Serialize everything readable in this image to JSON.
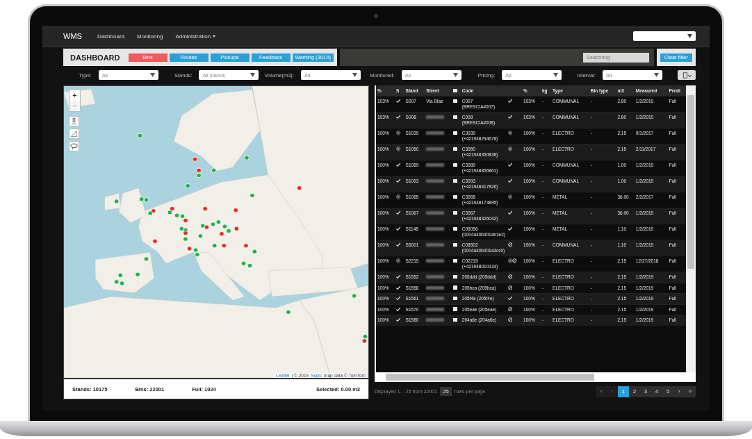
{
  "navbar": {
    "brand": "WMS",
    "items": [
      {
        "label": "Dashboard",
        "dropdown": false
      },
      {
        "label": "Monitoring",
        "dropdown": false
      },
      {
        "label": "Administration",
        "dropdown": true
      }
    ]
  },
  "toolbar": {
    "title": "DASHBOARD",
    "tabs": [
      {
        "label": "Bins",
        "selected": true
      },
      {
        "label": "Routes",
        "selected": false
      },
      {
        "label": "Pickups",
        "selected": false
      },
      {
        "label": "Feedback",
        "selected": false
      },
      {
        "label": "Warning (3014)",
        "selected": false
      }
    ],
    "search": {
      "placeholder": "Searching"
    },
    "clear_button": "Clear filter"
  },
  "filters": [
    {
      "label": "Type:",
      "value": "All"
    },
    {
      "label": "Stands:",
      "value": "All stands"
    },
    {
      "label": "Volume(m3):",
      "value": "All"
    },
    {
      "label": "Monitored:",
      "value": "All"
    },
    {
      "label": "Pricing:",
      "value": "All"
    },
    {
      "label": "Interval:",
      "value": "All"
    }
  ],
  "map": {
    "zoom_in": "+",
    "zoom_out": "−",
    "zoom_out_disabled": true,
    "attribution": [
      {
        "text": "Leaflet",
        "link": true
      },
      {
        "text": "| © 2019",
        "link": false
      },
      {
        "text": "Sygic",
        "link": true
      },
      {
        "text": "map data © TomTom",
        "link": false
      }
    ],
    "stats": [
      "Stands: 10175",
      "Bins: 22001",
      "Full: 1024",
      "Selected: 0.00 m3"
    ]
  },
  "table": {
    "columns": [
      "%",
      "S",
      "Stand",
      "Street",
      "",
      "Code",
      "",
      "%",
      "kg",
      "Type",
      "Bin type",
      "m3",
      "Measured",
      "Predi"
    ],
    "header_checked": false,
    "rows": [
      {
        "pct": "103%",
        "status": {
          "kind": "check"
        },
        "stand": "S007",
        "street": "Via Diaz",
        "checked": false,
        "code": "C007 (BRESCIA#007)",
        "code_status": [
          {
            "kind": "check"
          }
        ],
        "pct2": "103%",
        "kg": "-",
        "type": "COMMUNAL",
        "bin_type": "-",
        "m3": "2.80",
        "measured": "1/2/2019",
        "pred": "Full"
      },
      {
        "pct": "103%",
        "status": {
          "kind": "check"
        },
        "stand": "S008",
        "checked": false,
        "code": "C008 (BRESCIA#008)",
        "code_status": [
          {
            "kind": "check"
          }
        ],
        "pct2": "103%",
        "kg": "-",
        "type": "COMMUNAL",
        "bin_type": "-",
        "m3": "2.80",
        "measured": "1/2/2019",
        "pred": "Full"
      },
      {
        "pct": "100%",
        "status": {
          "kind": "gear"
        },
        "stand": "S1039",
        "checked": false,
        "code": "C3039 (+421948294678)",
        "code_status": [
          {
            "kind": "gear"
          }
        ],
        "pct2": "100%",
        "kg": "-",
        "type": "ELECTRO",
        "bin_type": "-",
        "m3": "2.15",
        "measured": "9/1/2017",
        "pred": "Full"
      },
      {
        "pct": "100%",
        "status": {
          "kind": "gear"
        },
        "stand": "S1050",
        "checked": false,
        "code": "C3050 (+421948350838)",
        "code_status": [
          {
            "kind": "gear"
          }
        ],
        "pct2": "100%",
        "kg": "-",
        "type": "ELECTRO",
        "bin_type": "-",
        "m3": "2.15",
        "measured": "2/11/2017",
        "pred": "Full"
      },
      {
        "pct": "100%",
        "status": {
          "kind": "check"
        },
        "stand": "S1089",
        "checked": false,
        "code": "C3089 (+421948856861)",
        "code_status": [
          {
            "kind": "check"
          }
        ],
        "pct2": "100%",
        "kg": "-",
        "type": "COMMUNAL",
        "bin_type": "-",
        "m3": "1.00",
        "measured": "1/2/2019",
        "pred": "Full"
      },
      {
        "pct": "100%",
        "status": {
          "kind": "check"
        },
        "stand": "S1093",
        "checked": false,
        "code": "C3093 (+421948417826)",
        "code_status": [
          {
            "kind": "check"
          }
        ],
        "pct2": "100%",
        "kg": "-",
        "type": "COMMUNAL",
        "bin_type": "-",
        "m3": "1.00",
        "measured": "1/2/2019",
        "pred": "Full"
      },
      {
        "pct": "100%",
        "status": {
          "kind": "gear"
        },
        "stand": "S1065",
        "checked": false,
        "code": "C3065 (+421948173895)",
        "code_status": [
          {
            "kind": "gear"
          }
        ],
        "pct2": "100%",
        "kg": "-",
        "type": "METAL",
        "bin_type": "-",
        "m3": "36.00",
        "measured": "2/2/2017",
        "pred": "Full"
      },
      {
        "pct": "100%",
        "status": {
          "kind": "check"
        },
        "stand": "S1067",
        "checked": false,
        "code": "C3067 (+421948326042)",
        "code_status": [
          {
            "kind": "check"
          }
        ],
        "pct2": "100%",
        "kg": "-",
        "type": "METAL",
        "bin_type": "-",
        "m3": "36.00",
        "measured": "1/2/2019",
        "pred": "Full"
      },
      {
        "pct": "100%",
        "status": {
          "kind": "check"
        },
        "stand": "S1148",
        "checked": false,
        "code": "C05056 (0004a30b001ab1e2)",
        "code_status": [
          {
            "kind": "check"
          }
        ],
        "pct2": "100%",
        "kg": "-",
        "type": "METAL",
        "bin_type": "-",
        "m3": "1.10",
        "measured": "1/2/2019",
        "pred": "Full"
      },
      {
        "pct": "100%",
        "status": {
          "kind": "check"
        },
        "stand": "S5001",
        "checked": false,
        "code": "C05502 (0004a30b001a3cc0)",
        "code_status": [
          {
            "kind": "ban"
          }
        ],
        "pct2": "100%",
        "kg": "-",
        "type": "COMMUNAL",
        "bin_type": "-",
        "m3": "1.10",
        "measured": "1/2/2019",
        "pred": "Full"
      },
      {
        "pct": "100%",
        "status": {
          "kind": "gear"
        },
        "stand": "S2215",
        "checked": false,
        "code": "C02215 (+421948010134)",
        "code_status": [
          {
            "kind": "gear"
          },
          {
            "kind": "ban"
          }
        ],
        "pct2": "100%",
        "kg": "-",
        "type": "ELECTRO",
        "bin_type": "-",
        "m3": "2.15",
        "measured": "12/27/2018",
        "pred": "Full"
      },
      {
        "pct": "100%",
        "status": {
          "kind": "check"
        },
        "stand": "S1552",
        "checked": false,
        "code": "205ddd (205ddd)",
        "code_status": [
          {
            "kind": "ban"
          }
        ],
        "pct2": "100%",
        "kg": "-",
        "type": "ELECTRO",
        "bin_type": "-",
        "m3": "2.15",
        "measured": "1/2/2019",
        "pred": "Full"
      },
      {
        "pct": "100%",
        "status": {
          "kind": "check"
        },
        "stand": "S1558",
        "checked": false,
        "code": "205bca (205bca)",
        "code_status": [
          {
            "kind": "ban"
          }
        ],
        "pct2": "100%",
        "kg": "-",
        "type": "ELECTRO",
        "bin_type": "-",
        "m3": "2.15",
        "measured": "1/2/2019",
        "pred": "Full"
      },
      {
        "pct": "100%",
        "status": {
          "kind": "check"
        },
        "stand": "S1561",
        "checked": false,
        "code": "205f4e (205f4e)",
        "code_status": [
          {
            "kind": "check"
          }
        ],
        "pct2": "100%",
        "kg": "-",
        "type": "ELECTRO",
        "bin_type": "-",
        "m3": "2.15",
        "measured": "1/2/2019",
        "pred": "Full"
      },
      {
        "pct": "100%",
        "status": {
          "kind": "check"
        },
        "stand": "S1570",
        "checked": false,
        "code": "205eae (205eae)",
        "code_status": [
          {
            "kind": "ban"
          }
        ],
        "pct2": "100%",
        "kg": "-",
        "type": "ELECTRO",
        "bin_type": "-",
        "m3": "2.15",
        "measured": "1/2/2019",
        "pred": "Full"
      },
      {
        "pct": "100%",
        "status": {
          "kind": "check"
        },
        "stand": "S1580",
        "checked": false,
        "code": "204a6e (204a6e)",
        "code_status": [
          {
            "kind": "ban"
          }
        ],
        "pct2": "100%",
        "kg": "-",
        "type": "ELECTRO",
        "bin_type": "-",
        "m3": "2.15",
        "measured": "1/2/2019",
        "pred": "Full"
      }
    ]
  },
  "pagination": {
    "info": "Displayed 1. - 25 from 22001",
    "page_size": "25",
    "page_size_label": "rows per page",
    "pages": [
      {
        "label": "«",
        "selected": false,
        "disabled": true
      },
      {
        "label": "‹",
        "selected": false,
        "disabled": true
      },
      {
        "label": "1",
        "selected": true,
        "disabled": false
      },
      {
        "label": "2",
        "selected": false,
        "disabled": false
      },
      {
        "label": "3",
        "selected": false,
        "disabled": false
      },
      {
        "label": "4",
        "selected": false,
        "disabled": false
      },
      {
        "label": "5",
        "selected": false,
        "disabled": false
      },
      {
        "label": "›",
        "selected": false,
        "disabled": false
      },
      {
        "label": "»",
        "selected": false,
        "disabled": false
      }
    ]
  }
}
